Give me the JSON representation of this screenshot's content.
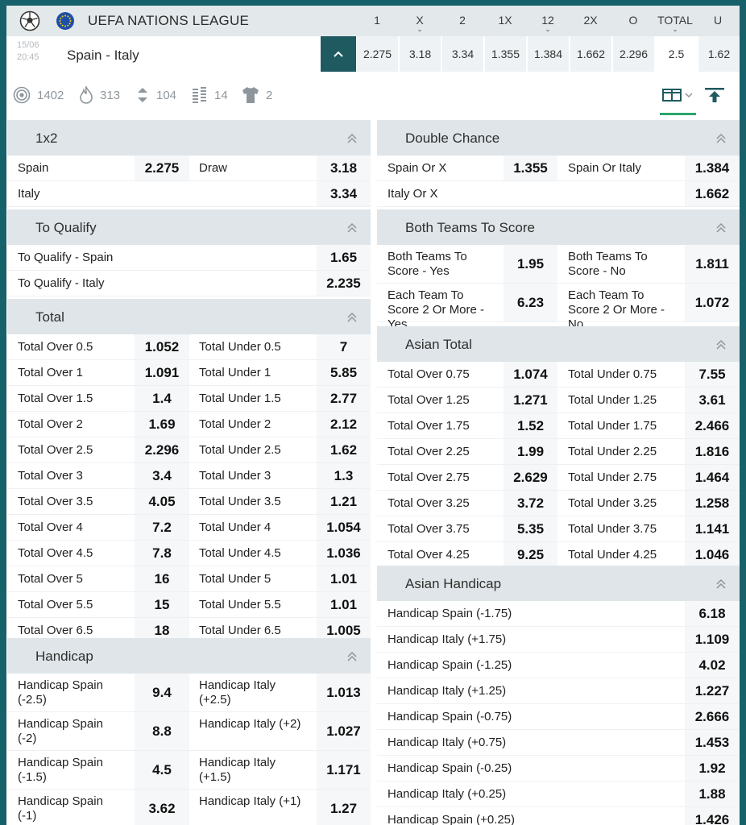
{
  "league": {
    "name": "UEFA NATIONS LEAGUE",
    "columns": [
      "1",
      "X",
      "2",
      "1X",
      "12",
      "2X",
      "O",
      "TOTAL",
      "U"
    ]
  },
  "match": {
    "date": "15/06",
    "time": "20:45",
    "teams": "Spain - Italy",
    "odds": [
      "2.275",
      "3.18",
      "3.34",
      "1.355",
      "1.384",
      "1.662",
      "2.296",
      "2.5",
      "1.62"
    ]
  },
  "stats": {
    "markets": "1402",
    "hot": "313",
    "updown": "104",
    "stats": "14",
    "shirt": "2"
  },
  "m1x2": {
    "title": "1x2",
    "rows": [
      {
        "a_label": "Spain",
        "a_odd": "2.275",
        "b_label": "Draw",
        "b_odd": "3.18"
      },
      {
        "a_label": "Italy",
        "a_odd": "",
        "b_label": "",
        "b_odd": "3.34"
      }
    ]
  },
  "qualify": {
    "title": "To Qualify",
    "rows": [
      {
        "label": "To Qualify - Spain",
        "odd": "1.65"
      },
      {
        "label": "To Qualify - Italy",
        "odd": "2.235"
      }
    ]
  },
  "total": {
    "title": "Total",
    "rows": [
      {
        "a_label": "Total Over 0.5",
        "a_odd": "1.052",
        "b_label": "Total Under 0.5",
        "b_odd": "7"
      },
      {
        "a_label": "Total Over 1",
        "a_odd": "1.091",
        "b_label": "Total Under 1",
        "b_odd": "5.85"
      },
      {
        "a_label": "Total Over 1.5",
        "a_odd": "1.4",
        "b_label": "Total Under 1.5",
        "b_odd": "2.77"
      },
      {
        "a_label": "Total Over 2",
        "a_odd": "1.69",
        "b_label": "Total Under 2",
        "b_odd": "2.12"
      },
      {
        "a_label": "Total Over 2.5",
        "a_odd": "2.296",
        "b_label": "Total Under 2.5",
        "b_odd": "1.62"
      },
      {
        "a_label": "Total Over 3",
        "a_odd": "3.4",
        "b_label": "Total Under 3",
        "b_odd": "1.3"
      },
      {
        "a_label": "Total Over 3.5",
        "a_odd": "4.05",
        "b_label": "Total Under 3.5",
        "b_odd": "1.21"
      },
      {
        "a_label": "Total Over 4",
        "a_odd": "7.2",
        "b_label": "Total Under 4",
        "b_odd": "1.054"
      },
      {
        "a_label": "Total Over 4.5",
        "a_odd": "7.8",
        "b_label": "Total Under 4.5",
        "b_odd": "1.036"
      },
      {
        "a_label": "Total Over 5",
        "a_odd": "16",
        "b_label": "Total Under 5",
        "b_odd": "1.01"
      },
      {
        "a_label": "Total Over 5.5",
        "a_odd": "15",
        "b_label": "Total Under 5.5",
        "b_odd": "1.01"
      },
      {
        "a_label": "Total Over 6.5",
        "a_odd": "18",
        "b_label": "Total Under 6.5",
        "b_odd": "1.005"
      }
    ]
  },
  "handicap": {
    "title": "Handicap",
    "rows": [
      {
        "a_label": "Handicap Spain (-2.5)",
        "a_odd": "9.4",
        "b_label": "Handicap Italy (+2.5)",
        "b_odd": "1.013"
      },
      {
        "a_label": "Handicap Spain (-2)",
        "a_odd": "8.8",
        "b_label": "Handicap Italy (+2)",
        "b_odd": "1.027"
      },
      {
        "a_label": "Handicap Spain (-1.5)",
        "a_odd": "4.5",
        "b_label": "Handicap Italy (+1.5)",
        "b_odd": "1.171"
      },
      {
        "a_label": "Handicap Spain (-1)",
        "a_odd": "3.62",
        "b_label": "Handicap Italy (+1)",
        "b_odd": "1.27"
      }
    ]
  },
  "double": {
    "title": "Double Chance",
    "rows": [
      {
        "a_label": "Spain Or X",
        "a_odd": "1.355",
        "b_label": "Spain Or Italy",
        "b_odd": "1.384"
      },
      {
        "a_label": "Italy Or X",
        "a_odd": "",
        "b_label": "",
        "b_odd": "1.662"
      }
    ]
  },
  "btts": {
    "title": "Both Teams To Score",
    "rows": [
      {
        "a_label": "Both Teams To Score - Yes",
        "a_odd": "1.95",
        "b_label": "Both Teams To Score - No",
        "b_odd": "1.811"
      },
      {
        "a_label": "Each Team To Score 2 Or More - Yes",
        "a_odd": "6.23",
        "b_label": "Each Team To Score 2 Or More - No",
        "b_odd": "1.072"
      }
    ]
  },
  "asian_total": {
    "title": "Asian Total",
    "rows": [
      {
        "a_label": "Total Over 0.75",
        "a_odd": "1.074",
        "b_label": "Total Under 0.75",
        "b_odd": "7.55"
      },
      {
        "a_label": "Total Over 1.25",
        "a_odd": "1.271",
        "b_label": "Total Under 1.25",
        "b_odd": "3.61"
      },
      {
        "a_label": "Total Over 1.75",
        "a_odd": "1.52",
        "b_label": "Total Under 1.75",
        "b_odd": "2.466"
      },
      {
        "a_label": "Total Over 2.25",
        "a_odd": "1.99",
        "b_label": "Total Under 2.25",
        "b_odd": "1.816"
      },
      {
        "a_label": "Total Over 2.75",
        "a_odd": "2.629",
        "b_label": "Total Under 2.75",
        "b_odd": "1.464"
      },
      {
        "a_label": "Total Over 3.25",
        "a_odd": "3.72",
        "b_label": "Total Under 3.25",
        "b_odd": "1.258"
      },
      {
        "a_label": "Total Over 3.75",
        "a_odd": "5.35",
        "b_label": "Total Under 3.75",
        "b_odd": "1.141"
      },
      {
        "a_label": "Total Over 4.25",
        "a_odd": "9.25",
        "b_label": "Total Under 4.25",
        "b_odd": "1.046"
      }
    ]
  },
  "asian_handicap": {
    "title": "Asian Handicap",
    "rows": [
      {
        "label": "Handicap Spain (-1.75)",
        "odd": "6.18"
      },
      {
        "label": "Handicap Italy (+1.75)",
        "odd": "1.109"
      },
      {
        "label": "Handicap Spain (-1.25)",
        "odd": "4.02"
      },
      {
        "label": "Handicap Italy (+1.25)",
        "odd": "1.227"
      },
      {
        "label": "Handicap Spain (-0.75)",
        "odd": "2.666"
      },
      {
        "label": "Handicap Italy (+0.75)",
        "odd": "1.453"
      },
      {
        "label": "Handicap Spain (-0.25)",
        "odd": "1.92"
      },
      {
        "label": "Handicap Italy (+0.25)",
        "odd": "1.88"
      },
      {
        "label": "Handicap Spain (+0.25)",
        "odd": "1.426"
      }
    ]
  },
  "colors": {
    "accent": "#1e5a5f",
    "background": "#17616a",
    "header": "#dfe5e8",
    "active": "#2aa66b"
  }
}
